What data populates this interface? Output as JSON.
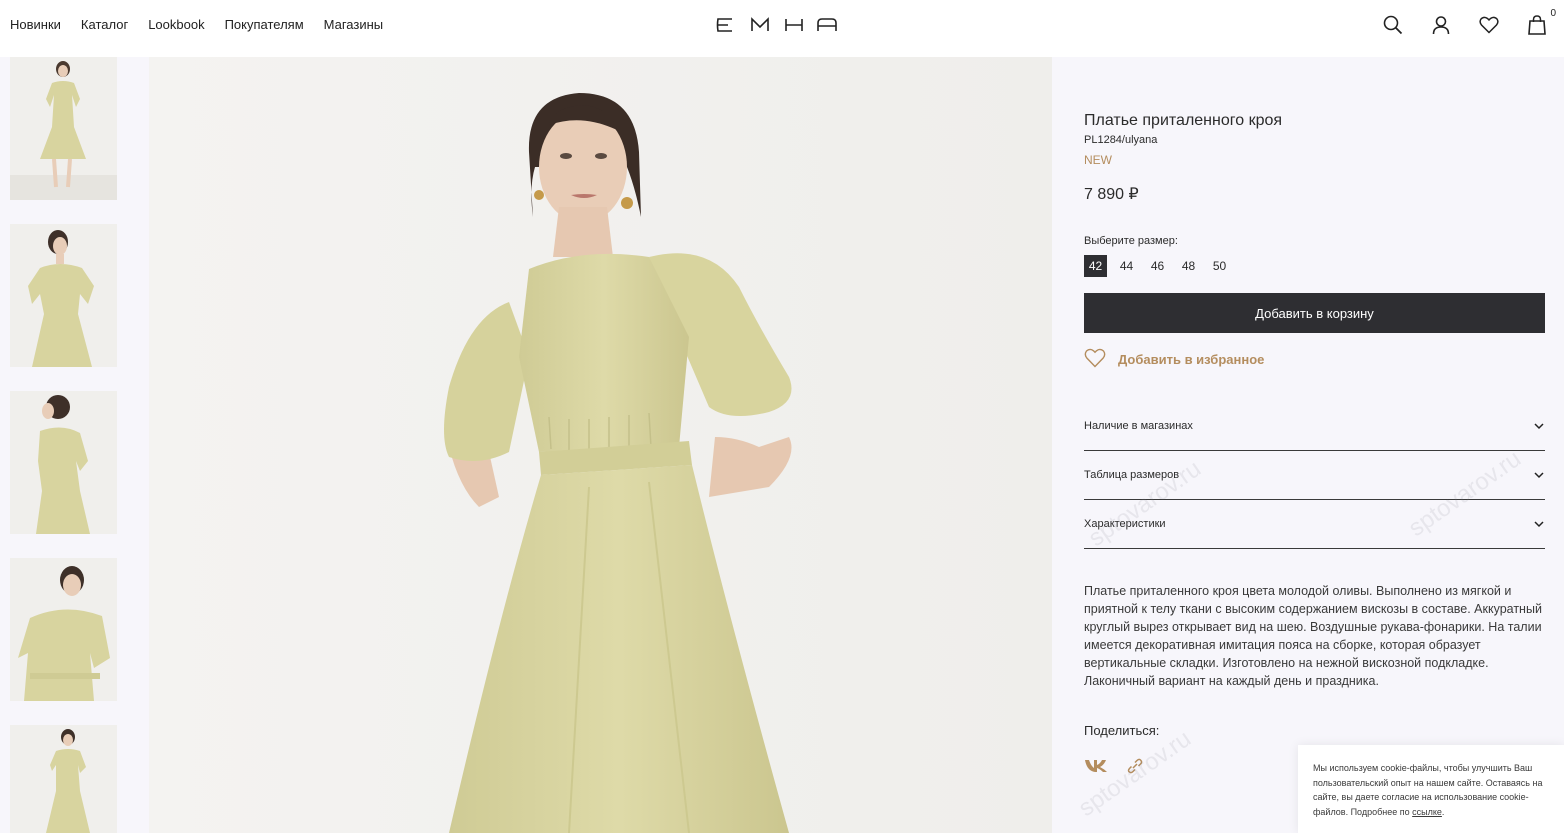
{
  "header": {
    "nav": [
      "Новинки",
      "Каталог",
      "Lookbook",
      "Покупателям",
      "Магазины"
    ],
    "logo": "EMKA",
    "cart_count": "0"
  },
  "product": {
    "title": "Платье приталенного кроя",
    "sku": "PL1284/ulyana",
    "badge": "NEW",
    "price": "7 890 ₽",
    "size_label": "Выберите размер:",
    "sizes": [
      "42",
      "44",
      "46",
      "48",
      "50"
    ],
    "selected_size": "42",
    "add_to_cart": "Добавить в корзину",
    "add_to_favorites": "Добавить в избранное",
    "accordion": [
      "Наличие в магазинах",
      "Таблица размеров",
      "Характеристики"
    ],
    "description": "Платье приталенного кроя цвета молодой оливы. Выполнено из мягкой и приятной к телу ткани с высоким содержанием вискозы в составе. Аккуратный круглый вырез открывает вид на шею. Воздушные рукава-фонарики. На талии имеется декоративная имитация пояса на сборке, которая образует вертикальные складки. Изготовлено на нежной вискозной подкладке. Лаконичный вариант на каждый день и праздника.",
    "share_label": "Поделиться:",
    "share_icons": [
      "vk-icon",
      "link-icon"
    ]
  },
  "cookie": {
    "text": "Мы используем cookie-файлы, чтобы улучшить Ваш пользовательский опыт на нашем сайте. Оставаясь на сайте, вы даете согласие на использование cookie-файлов. Подробнее по",
    "link": "ссылке",
    "end": "."
  },
  "watermark": "sptovarov.ru",
  "colors": {
    "accent": "#b48d5e",
    "dark_button": "#2e2e32",
    "dress": "#dcd8a4",
    "background": "#f7f6fb"
  }
}
